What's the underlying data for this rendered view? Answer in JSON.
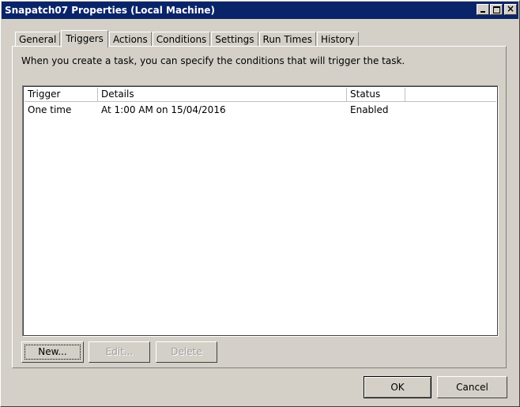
{
  "window": {
    "title": "Snapatch07 Properties (Local Machine)"
  },
  "tabs": [
    {
      "label": "General"
    },
    {
      "label": "Triggers"
    },
    {
      "label": "Actions"
    },
    {
      "label": "Conditions"
    },
    {
      "label": "Settings"
    },
    {
      "label": "Run Times"
    },
    {
      "label": "History"
    }
  ],
  "active_tab": "Triggers",
  "triggers_panel": {
    "description": "When you create a task, you can specify the conditions that will trigger the task.",
    "columns": [
      "Trigger",
      "Details",
      "Status"
    ],
    "rows": [
      {
        "trigger": "One time",
        "details": "At 1:00 AM on 15/04/2016",
        "status": "Enabled"
      }
    ],
    "buttons": {
      "new": "New...",
      "edit": "Edit...",
      "delete": "Delete"
    }
  },
  "dialog_buttons": {
    "ok": "OK",
    "cancel": "Cancel"
  },
  "colors": {
    "titlebar": "#0a246a",
    "face": "#d4d0c8",
    "disabled_text": "#a0a0a0"
  }
}
